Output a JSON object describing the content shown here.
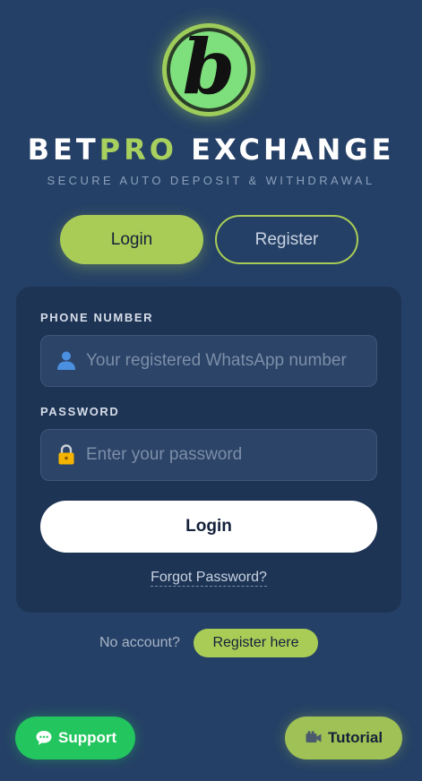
{
  "header": {
    "logo_letter": "b",
    "brand_primary": "BET",
    "brand_accent": "PRO",
    "brand_suffix": " EXCHANGE",
    "tagline": "SECURE AUTO DEPOSIT & WITHDRAWAL"
  },
  "tabs": {
    "login_label": "Login",
    "register_label": "Register",
    "active": "login"
  },
  "form": {
    "phone_label": "PHONE NUMBER",
    "phone_placeholder": "Your registered WhatsApp number",
    "phone_icon": "user-icon",
    "password_label": "PASSWORD",
    "password_placeholder": "Enter your password",
    "password_icon": "lock-icon",
    "submit_label": "Login",
    "forgot_label": "Forgot Password?"
  },
  "signup": {
    "prompt": "No account?",
    "link_label": "Register here"
  },
  "floating": {
    "support_label": "Support",
    "support_icon": "chat-bubble-icon",
    "tutorial_label": "Tutorial",
    "tutorial_icon": "video-camera-icon"
  },
  "colors": {
    "background": "#254066",
    "card": "#1e3455",
    "accent": "#a9cc57",
    "support_green": "#22c55e"
  }
}
